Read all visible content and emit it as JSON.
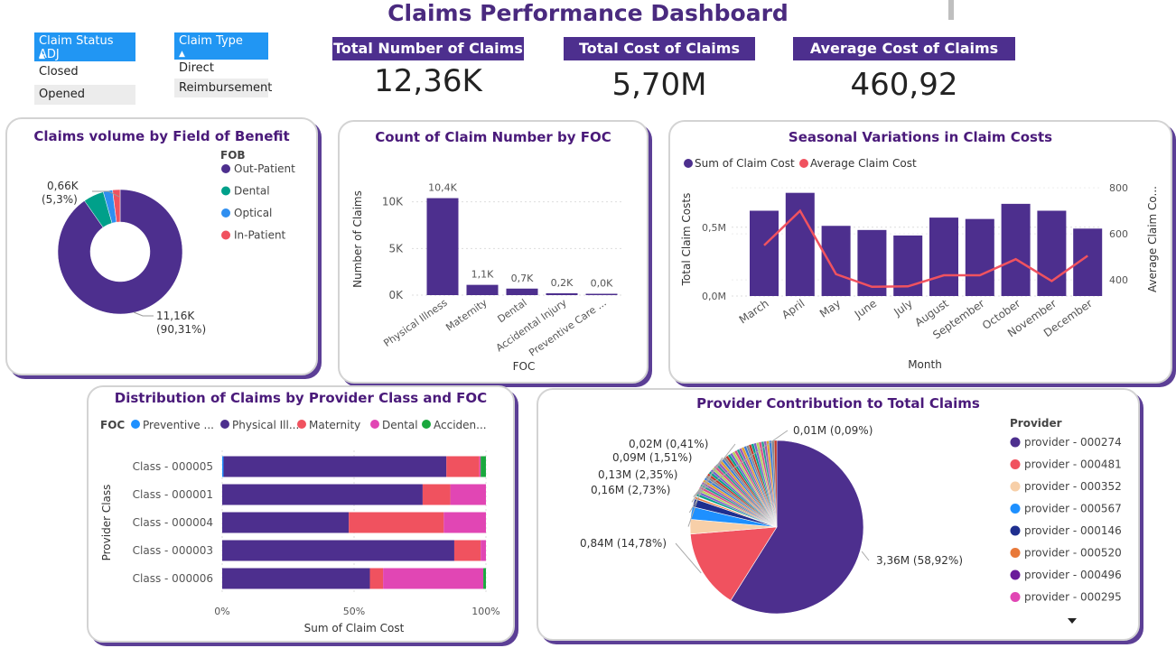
{
  "title": "Claims Performance Dashboard",
  "slicers": {
    "status": {
      "header": "Claim Status ADJ",
      "items": [
        "Closed",
        "Opened"
      ]
    },
    "type": {
      "header": "Claim Type",
      "items": [
        "Direct",
        "Reimbursement"
      ]
    }
  },
  "kpis": {
    "count": {
      "label": "Total Number of Claims",
      "value": "12,36K"
    },
    "cost": {
      "label": "Total Cost of Claims",
      "value": "5,70M"
    },
    "avg": {
      "label": "Average Cost of Claims",
      "value": "460,92"
    }
  },
  "colors": {
    "accent": "#4d2f8e",
    "line": "#f0525f",
    "slicer": "#2196f3"
  },
  "fob_chart": {
    "title": "Claims volume by Field of Benefit",
    "legend_title": "FOB",
    "big_label": [
      "11,16K",
      "(90,31%)"
    ],
    "small_label": [
      "0,66K",
      "(5,3%)"
    ]
  },
  "foc_chart": {
    "title": "Count of Claim Number by FOC",
    "xlabel": "FOC",
    "ylabel": "Number of Claims",
    "yticks": [
      "0K",
      "5K",
      "10K"
    ]
  },
  "season_chart": {
    "title": "Seasonal Variations in Claim Costs",
    "xlabel": "Month",
    "ylabel_left": "Total Claim Costs",
    "ylabel_right": "Average Claim Co...",
    "yticks_left": [
      "0,0M",
      "0,5M"
    ],
    "yticks_right": [
      "400",
      "600",
      "800"
    ]
  },
  "dist_chart": {
    "title": "Distribution of Claims by Provider Class and FOC",
    "legend_title": "FOC",
    "legend_labels": [
      "Preventive ...",
      "Physical Ill...",
      "Maternity",
      "Dental",
      "Acciden..."
    ],
    "xlabel": "Sum of Claim Cost",
    "ylabel": "Provider Class",
    "xticks": [
      "0%",
      "50%",
      "100%"
    ]
  },
  "provider_chart": {
    "title": "Provider Contribution to Total Claims",
    "legend_title": "Provider"
  },
  "chart_data": [
    {
      "type": "pie",
      "variant": "donut",
      "title": "Claims volume by Field of Benefit",
      "legend_title": "FOB",
      "labels": [
        "Out-Patient",
        "Dental",
        "Optical",
        "In-Patient"
      ],
      "values": [
        11.16,
        0.66,
        0.3,
        0.24
      ],
      "unit": "K",
      "colors": [
        "#4d2f8e",
        "#00a08a",
        "#2f8ff0",
        "#f0525f"
      ]
    },
    {
      "type": "bar",
      "title": "Count of Claim Number by FOC",
      "xlabel": "FOC",
      "ylabel": "Number of Claims",
      "categories": [
        "Physical Illness",
        "Maternity",
        "Dental",
        "Accidental Injury",
        "Preventive Care ..."
      ],
      "values": [
        10.4,
        1.1,
        0.7,
        0.2,
        0.0
      ],
      "data_labels": [
        "10,4K",
        "1,1K",
        "0,7K",
        "0,2K",
        "0,0K"
      ],
      "ylim": [
        0,
        12
      ]
    },
    {
      "type": "bar",
      "title": "Seasonal Variations in Claim Costs",
      "xlabel": "Month",
      "categories": [
        "March",
        "April",
        "May",
        "June",
        "July",
        "August",
        "September",
        "October",
        "November",
        "December"
      ],
      "series": [
        {
          "name": "Sum of Claim Cost",
          "kind": "bar",
          "axis": "left",
          "color": "#4d2f8e",
          "values": [
            0.62,
            0.75,
            0.51,
            0.48,
            0.44,
            0.57,
            0.56,
            0.67,
            0.62,
            0.49
          ]
        },
        {
          "name": "Average Claim Cost",
          "kind": "line",
          "axis": "right",
          "color": "#f0525f",
          "values": [
            550,
            700,
            425,
            370,
            372,
            420,
            420,
            490,
            395,
            505
          ]
        }
      ],
      "ylim_left": [
        0,
        0.82
      ],
      "ylim_right": [
        330,
        820
      ]
    },
    {
      "type": "bar",
      "orientation": "horizontal-100%-stacked",
      "title": "Distribution of Claims by Provider Class and FOC",
      "xlabel": "Sum of Claim Cost",
      "ylabel": "Provider Class",
      "categories": [
        "Class - 000005",
        "Class - 000001",
        "Class - 000004",
        "Class - 000003",
        "Class - 000006"
      ],
      "series": [
        {
          "name": "Preventive Care",
          "color": "#1e90ff",
          "values": [
            0.5,
            0,
            0,
            0,
            0
          ]
        },
        {
          "name": "Physical Illness",
          "color": "#4d2f8e",
          "values": [
            84.5,
            76,
            48,
            88,
            56
          ]
        },
        {
          "name": "Maternity",
          "color": "#f0525f",
          "values": [
            12.5,
            10.5,
            36,
            10,
            5
          ]
        },
        {
          "name": "Dental",
          "color": "#e146b4",
          "values": [
            0.5,
            13.5,
            16,
            2,
            38
          ]
        },
        {
          "name": "Accidental Injury",
          "color": "#1aa83e",
          "values": [
            2,
            0,
            0,
            0,
            1
          ]
        }
      ]
    },
    {
      "type": "pie",
      "title": "Provider Contribution to Total Claims",
      "legend_title": "Provider",
      "labels": [
        "provider - 000274",
        "provider - 000481",
        "provider - 000352",
        "provider - 000567",
        "provider - 000146",
        "provider - 000520",
        "provider - 000496",
        "provider - 000295"
      ],
      "values": [
        58.92,
        14.78,
        2.73,
        2.35,
        1.51,
        0.41,
        0.09,
        0.09
      ],
      "value_unit": "%",
      "colors": [
        "#4d2f8e",
        "#f0525f",
        "#f7cfa8",
        "#1e90ff",
        "#1f2f8f",
        "#e8793a",
        "#6a1b9a",
        "#e146b4"
      ],
      "data_labels": [
        "3,36M (58,92%)",
        "0,84M (14,78%)",
        "0,16M (2,73%)",
        "0,13M (2,35%)",
        "0,09M (1,51%)",
        "0,02M (0,41%)",
        "0,01M (0,09%)"
      ]
    }
  ]
}
